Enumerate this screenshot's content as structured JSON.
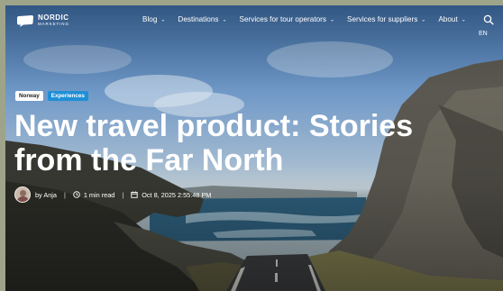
{
  "brand": {
    "name_line1": "NORDIC",
    "name_line2": "MARKETING",
    "logo_icon": "speech-bubble-logo-icon"
  },
  "nav": {
    "items": [
      {
        "label": "Blog"
      },
      {
        "label": "Destinations"
      },
      {
        "label": "Services for tour operators"
      },
      {
        "label": "Services for suppliers"
      },
      {
        "label": "About"
      }
    ],
    "chevron": "⌄",
    "search_icon": "search-icon",
    "language": "EN"
  },
  "article": {
    "tags": [
      "Norway",
      "Experiences"
    ],
    "title": "New travel product: Stories from the Far North",
    "author": "by Anja",
    "read_time": "1 min read",
    "date": "Oct 8, 2025 2:55:48 PM"
  },
  "colors": {
    "tag_blue": "#1f8fd6",
    "text": "#ffffff",
    "frame": "#9ea48a"
  }
}
